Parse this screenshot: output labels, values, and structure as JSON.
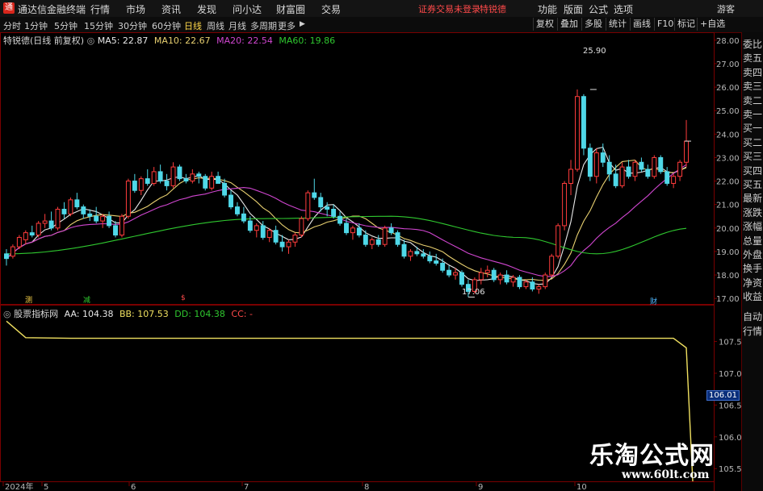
{
  "menu": {
    "app_title": "通达信金融终端",
    "items": [
      "行情",
      "市场",
      "资讯",
      "发现",
      "问小达",
      "财富圈",
      "交易"
    ],
    "notice": "证券交易未登录",
    "stock_name_red": "特锐德",
    "right_items": [
      "功能",
      "版面",
      "公式",
      "选项"
    ],
    "guest": "游客"
  },
  "periods": [
    "分时",
    "1分钟",
    "5分钟",
    "15分钟",
    "30分钟",
    "60分钟",
    "日线",
    "周线",
    "月线",
    "多周期",
    "更多"
  ],
  "active_period": "日线",
  "toolbar": [
    "复权",
    "叠加",
    "多股",
    "统计",
    "画线",
    "F10",
    "标记",
    "+自选"
  ],
  "legend_main": {
    "title": "特锐德(日线 前复权)",
    "ma5": "MA5: 22.87",
    "ma10": "MA10: 22.67",
    "ma20": "MA20: 22.54",
    "ma60": "MA60: 19.86"
  },
  "legend_sub": {
    "title": "股票指标网",
    "aa": "AA: 104.38",
    "bb": "BB: 107.53",
    "dd": "DD: 104.38",
    "cc": "CC: -"
  },
  "colors": {
    "up": "#ff3c3c",
    "down": "#4fd8e8",
    "ma5": "#e8e8e8",
    "ma10": "#e8d070",
    "ma20": "#d046d0",
    "ma60": "#2fc82f",
    "sub": "#f0e060"
  },
  "side_panel": [
    "委比",
    "卖五",
    "卖四",
    "卖三",
    "卖二",
    "卖一",
    "买一",
    "买二",
    "买三",
    "买四",
    "买五",
    "最新",
    "涨跌",
    "涨幅",
    "总量",
    "外盘",
    "换手",
    "净资",
    "收益",
    "自动",
    "行情"
  ],
  "price_scale": [
    "28.00",
    "27.00",
    "26.00",
    "25.00",
    "24.00",
    "23.00",
    "22.00",
    "21.00",
    "20.00",
    "19.00",
    "18.00",
    "17.00"
  ],
  "sub_scale": [
    "107.5",
    "107.0",
    "106.5",
    "106.0",
    "105.5"
  ],
  "current_badge": "106.01",
  "x_axis": [
    "2024年",
    "5",
    "6",
    "7",
    "8",
    "9",
    "10"
  ],
  "annotations": {
    "high": "25.90",
    "low": "17.06"
  },
  "markers": [
    "测",
    "减",
    "$",
    "财"
  ],
  "watermark": {
    "cn": "乐淘公式网",
    "url": "www.60lt.com"
  },
  "chart_data": {
    "type": "candlestick",
    "ylim": [
      16.8,
      28.2
    ],
    "sub_ylim": [
      105.3,
      107.9
    ],
    "candles": [
      [
        18.9,
        19.1,
        18.4,
        18.7
      ],
      [
        18.8,
        19.3,
        18.7,
        19.2
      ],
      [
        19.2,
        19.7,
        19.1,
        19.6
      ],
      [
        19.5,
        19.9,
        19.3,
        19.8
      ],
      [
        19.8,
        20.1,
        19.6,
        19.7
      ],
      [
        19.7,
        20.3,
        19.6,
        20.2
      ],
      [
        20.2,
        20.6,
        20.0,
        20.3
      ],
      [
        20.3,
        20.7,
        19.9,
        20.0
      ],
      [
        20.0,
        20.9,
        19.9,
        20.8
      ],
      [
        20.8,
        21.1,
        20.4,
        20.6
      ],
      [
        20.6,
        21.3,
        20.5,
        21.2
      ],
      [
        21.2,
        21.5,
        20.8,
        20.9
      ],
      [
        20.9,
        21.0,
        20.4,
        20.6
      ],
      [
        20.6,
        20.8,
        20.3,
        20.5
      ],
      [
        20.5,
        20.9,
        20.2,
        20.3
      ],
      [
        20.3,
        20.6,
        20.0,
        20.5
      ],
      [
        20.5,
        20.7,
        20.0,
        20.1
      ],
      [
        20.1,
        20.3,
        19.6,
        19.7
      ],
      [
        19.7,
        20.6,
        19.6,
        20.5
      ],
      [
        20.5,
        22.1,
        20.4,
        22.0
      ],
      [
        22.0,
        22.3,
        21.5,
        21.6
      ],
      [
        21.6,
        22.2,
        21.4,
        22.1
      ],
      [
        22.1,
        22.5,
        21.8,
        21.9
      ],
      [
        21.9,
        22.6,
        21.8,
        22.4
      ],
      [
        22.4,
        22.7,
        21.9,
        22.0
      ],
      [
        22.0,
        22.3,
        21.6,
        21.8
      ],
      [
        21.8,
        22.8,
        21.7,
        22.6
      ],
      [
        22.6,
        22.7,
        22.0,
        22.1
      ],
      [
        22.1,
        22.3,
        21.9,
        22.0
      ],
      [
        22.0,
        22.5,
        21.9,
        22.3
      ],
      [
        22.3,
        22.4,
        21.9,
        22.2
      ],
      [
        22.2,
        22.3,
        21.6,
        21.7
      ],
      [
        21.7,
        22.4,
        21.6,
        22.2
      ],
      [
        22.2,
        22.4,
        21.9,
        21.9
      ],
      [
        21.9,
        22.1,
        21.3,
        21.4
      ],
      [
        21.4,
        21.6,
        20.8,
        20.9
      ],
      [
        20.9,
        21.1,
        20.5,
        20.6
      ],
      [
        20.6,
        20.9,
        20.2,
        20.3
      ],
      [
        20.3,
        20.5,
        19.8,
        19.9
      ],
      [
        19.9,
        20.2,
        19.6,
        20.1
      ],
      [
        20.1,
        20.3,
        19.5,
        19.6
      ],
      [
        19.6,
        20.0,
        19.4,
        19.9
      ],
      [
        19.9,
        20.1,
        19.3,
        19.4
      ],
      [
        19.4,
        19.7,
        19.0,
        19.2
      ],
      [
        19.2,
        19.5,
        18.9,
        19.4
      ],
      [
        19.4,
        19.8,
        19.2,
        19.7
      ],
      [
        19.7,
        20.5,
        19.6,
        20.4
      ],
      [
        20.4,
        21.6,
        20.3,
        21.5
      ],
      [
        21.5,
        22.1,
        21.2,
        21.3
      ],
      [
        21.3,
        21.5,
        20.7,
        20.9
      ],
      [
        20.9,
        21.1,
        20.5,
        20.8
      ],
      [
        20.8,
        21.0,
        20.4,
        20.5
      ],
      [
        20.5,
        20.7,
        20.1,
        20.2
      ],
      [
        20.2,
        20.4,
        19.7,
        19.8
      ],
      [
        19.8,
        20.1,
        19.5,
        20.0
      ],
      [
        20.0,
        20.2,
        19.6,
        19.7
      ],
      [
        19.7,
        19.9,
        19.2,
        19.3
      ],
      [
        19.3,
        19.6,
        19.1,
        19.5
      ],
      [
        19.5,
        19.7,
        19.2,
        19.3
      ],
      [
        19.3,
        20.1,
        19.2,
        20.0
      ],
      [
        20.0,
        20.2,
        19.7,
        19.8
      ],
      [
        19.8,
        19.9,
        19.2,
        19.3
      ],
      [
        19.3,
        19.5,
        18.7,
        18.8
      ],
      [
        18.8,
        19.1,
        18.6,
        19.0
      ],
      [
        19.0,
        19.2,
        18.8,
        18.9
      ],
      [
        18.9,
        19.1,
        18.7,
        18.8
      ],
      [
        18.8,
        19.0,
        18.5,
        18.6
      ],
      [
        18.6,
        18.9,
        18.4,
        18.5
      ],
      [
        18.5,
        18.7,
        18.1,
        18.2
      ],
      [
        18.2,
        18.4,
        17.9,
        18.0
      ],
      [
        18.0,
        18.3,
        17.8,
        18.1
      ],
      [
        18.1,
        18.2,
        17.5,
        17.6
      ],
      [
        17.6,
        17.8,
        17.06,
        17.3
      ],
      [
        17.3,
        17.9,
        17.2,
        17.8
      ],
      [
        17.8,
        18.3,
        17.6,
        18.1
      ],
      [
        18.1,
        18.4,
        17.9,
        18.2
      ],
      [
        18.2,
        18.3,
        17.7,
        17.8
      ],
      [
        17.8,
        18.1,
        17.6,
        18.0
      ],
      [
        18.0,
        18.2,
        17.6,
        17.7
      ],
      [
        17.7,
        18.0,
        17.5,
        17.9
      ],
      [
        17.9,
        18.0,
        17.4,
        17.5
      ],
      [
        17.5,
        17.8,
        17.4,
        17.7
      ],
      [
        17.7,
        17.9,
        17.3,
        17.4
      ],
      [
        17.4,
        17.6,
        17.2,
        17.5
      ],
      [
        17.5,
        18.1,
        17.4,
        18.0
      ],
      [
        18.0,
        18.9,
        17.9,
        18.8
      ],
      [
        18.8,
        20.2,
        18.7,
        20.1
      ],
      [
        20.1,
        22.0,
        19.9,
        21.9
      ],
      [
        21.9,
        22.9,
        21.4,
        22.5
      ],
      [
        22.5,
        25.9,
        22.4,
        25.6
      ],
      [
        25.6,
        25.7,
        23.1,
        23.4
      ],
      [
        23.4,
        23.6,
        22.0,
        22.2
      ],
      [
        22.2,
        23.4,
        21.9,
        23.2
      ],
      [
        23.2,
        23.6,
        22.6,
        22.8
      ],
      [
        22.8,
        23.1,
        22.0,
        22.3
      ],
      [
        22.3,
        22.7,
        21.7,
        21.8
      ],
      [
        21.8,
        22.8,
        21.7,
        22.6
      ],
      [
        22.6,
        22.9,
        22.1,
        22.2
      ],
      [
        22.2,
        22.9,
        22.0,
        22.8
      ],
      [
        22.8,
        23.0,
        22.4,
        22.5
      ],
      [
        22.5,
        22.7,
        22.1,
        22.2
      ],
      [
        22.2,
        23.1,
        22.1,
        23.0
      ],
      [
        23.0,
        23.1,
        22.3,
        22.4
      ],
      [
        22.4,
        22.6,
        21.8,
        21.9
      ],
      [
        21.9,
        22.3,
        21.7,
        22.2
      ],
      [
        22.2,
        22.9,
        22.0,
        22.8
      ],
      [
        22.8,
        24.6,
        22.6,
        23.7
      ]
    ],
    "ma60_anchors": [
      [
        0,
        18.9
      ],
      [
        40,
        20.4
      ],
      [
        60,
        20.5
      ],
      [
        80,
        19.6
      ],
      [
        92,
        18.9
      ],
      [
        107,
        20.0
      ]
    ],
    "sub_series": [
      [
        0,
        107.82
      ],
      [
        3,
        107.56
      ],
      [
        10,
        107.55
      ],
      [
        104,
        107.55
      ],
      [
        106,
        107.4
      ],
      [
        107,
        105.3
      ]
    ]
  }
}
